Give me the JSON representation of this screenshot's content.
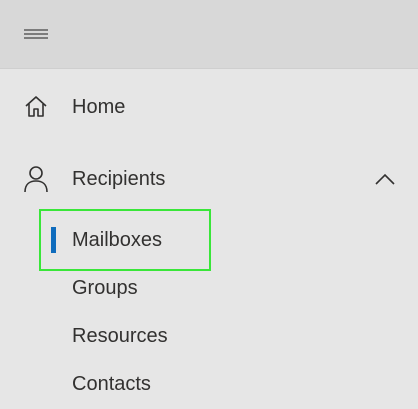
{
  "topbar": {
    "menu_icon": "hamburger-menu-icon"
  },
  "nav": {
    "home": {
      "label": "Home",
      "icon": "home-icon"
    },
    "recipients": {
      "label": "Recipients",
      "icon": "person-icon",
      "expanded": true,
      "chevron_icon": "chevron-up-icon",
      "children": [
        {
          "label": "Mailboxes",
          "selected": true
        },
        {
          "label": "Groups",
          "selected": false
        },
        {
          "label": "Resources",
          "selected": false
        },
        {
          "label": "Contacts",
          "selected": false
        }
      ]
    }
  },
  "colors": {
    "selected_indicator": "#0f6cbd",
    "highlight_outline": "#39e639",
    "background": "#e6e6e6",
    "topbar": "#d8d8d8"
  }
}
